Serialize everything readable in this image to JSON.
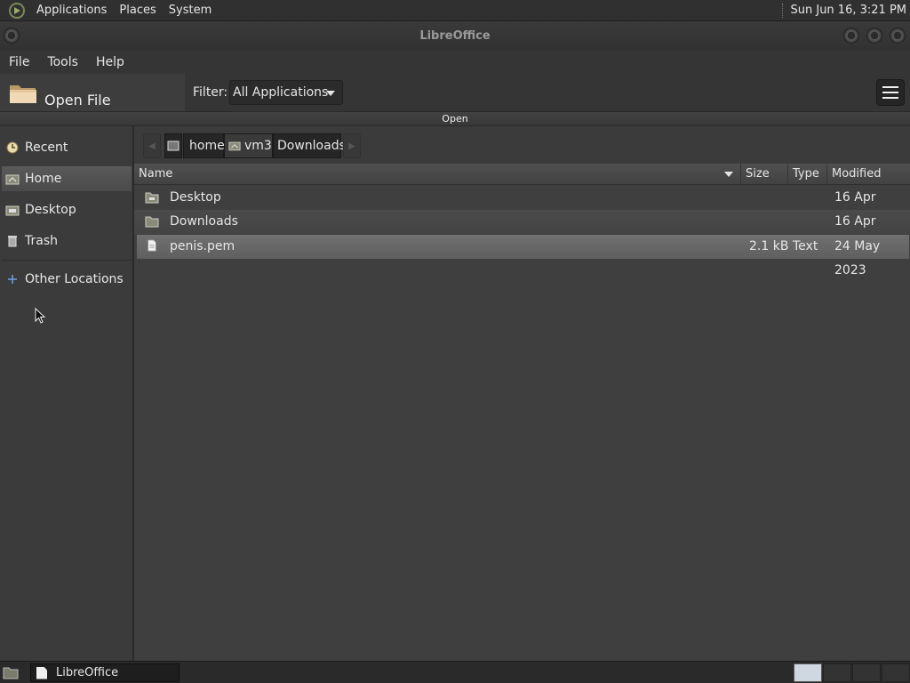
{
  "top_panel": {
    "menus": [
      "Applications",
      "Places",
      "System"
    ],
    "clock": "Sun Jun 16,  3:21 PM"
  },
  "window": {
    "title": "LibreOffice"
  },
  "menubar": {
    "items": [
      "File",
      "Tools",
      "Help"
    ]
  },
  "toolbar": {
    "open_file_label": "Open File",
    "filter_label": "Filter:",
    "filter_value": "All Applications"
  },
  "dialog": {
    "header": "Open"
  },
  "sidebar": {
    "items": [
      {
        "label": "Recent",
        "icon": "recent-icon"
      },
      {
        "label": "Home",
        "icon": "home-icon",
        "selected": true
      },
      {
        "label": "Desktop",
        "icon": "desktop-icon"
      },
      {
        "label": "Trash",
        "icon": "trash-icon"
      },
      {
        "label": "Other Locations",
        "icon": "plus-icon"
      }
    ]
  },
  "pathbar": {
    "crumbs": [
      "home",
      "vm3",
      "Downloads"
    ]
  },
  "file_list": {
    "columns": [
      "Name",
      "Size",
      "Type",
      "Modified"
    ],
    "rows": [
      {
        "name": "Desktop",
        "size": "",
        "type": "",
        "modified": "16 Apr",
        "kind": "folder"
      },
      {
        "name": "Downloads",
        "size": "",
        "type": "",
        "modified": "16 Apr",
        "kind": "folder"
      },
      {
        "name": "penis.pem",
        "size": "2.1 kB",
        "type": "Text",
        "modified": "24 May 2023",
        "kind": "file"
      }
    ]
  },
  "taskbar": {
    "task_label": "LibreOffice"
  }
}
